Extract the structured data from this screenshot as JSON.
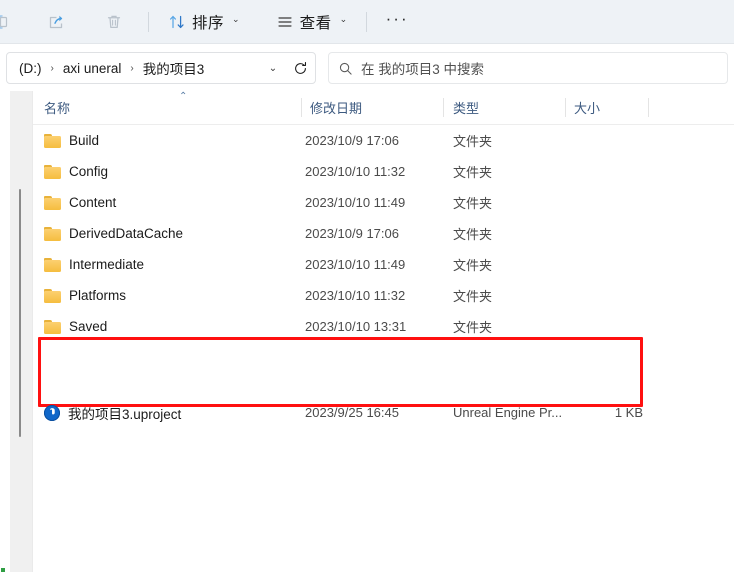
{
  "toolbar": {
    "buttons": [
      {
        "name": "rename-icon",
        "label": ""
      },
      {
        "name": "share-icon",
        "label": ""
      },
      {
        "name": "delete-icon",
        "label": ""
      }
    ],
    "sort_label": "排序",
    "view_label": "查看",
    "more_label": "···"
  },
  "addressbar": {
    "crumbs": [
      "(D:)",
      "axi uneral",
      "我的项目3"
    ],
    "separator": "›",
    "dropdown_icon": "chevron-down-icon",
    "refresh_icon": "refresh-icon"
  },
  "search": {
    "placeholder": "在 我的项目3 中搜索",
    "icon": "search-icon"
  },
  "columns": {
    "name": "名称",
    "date": "修改日期",
    "type": "类型",
    "size": "大小",
    "sort_caret": "⌃"
  },
  "files": [
    {
      "icon": "folder-icon",
      "name": "Build",
      "date": "2023/10/9 17:06",
      "type": "文件夹",
      "size": ""
    },
    {
      "icon": "folder-icon",
      "name": "Config",
      "date": "2023/10/10 11:32",
      "type": "文件夹",
      "size": ""
    },
    {
      "icon": "folder-icon",
      "name": "Content",
      "date": "2023/10/10 11:49",
      "type": "文件夹",
      "size": ""
    },
    {
      "icon": "folder-icon",
      "name": "DerivedDataCache",
      "date": "2023/10/9 17:06",
      "type": "文件夹",
      "size": ""
    },
    {
      "icon": "folder-icon",
      "name": "Intermediate",
      "date": "2023/10/10 11:49",
      "type": "文件夹",
      "size": ""
    },
    {
      "icon": "folder-icon",
      "name": "Platforms",
      "date": "2023/10/10 11:32",
      "type": "文件夹",
      "size": ""
    },
    {
      "icon": "folder-icon",
      "name": "Saved",
      "date": "2023/10/10 13:31",
      "type": "文件夹",
      "size": ""
    },
    {
      "icon": "unreal-icon",
      "name": "我的项目3.uproject",
      "date": "2023/9/25 16:45",
      "type": "Unreal Engine Pr...",
      "size": "1 KB"
    }
  ],
  "annotation": {
    "shape": "rectangle",
    "color": "#ff1010",
    "target_row_index": 7
  }
}
